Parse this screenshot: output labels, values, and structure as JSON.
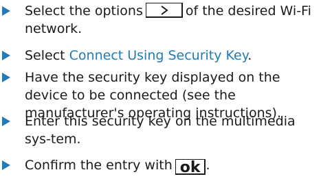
{
  "steps": [
    {
      "before": "Select the options",
      "icon": "chevron-right-icon",
      "after": "of the desired Wi-Fi network."
    },
    {
      "prefix": "Select ",
      "link": "Connect Using Security Key",
      "suffix": "."
    },
    {
      "text": "Have the security key displayed on the device to be connected (see the manufacturer's operating instructions)."
    },
    {
      "text": "Enter this security key on the multimedia sys-tem."
    },
    {
      "before": "Confirm the entry with",
      "key": "ok",
      "after": "."
    }
  ],
  "colors": {
    "accent": "#1f7ab8",
    "text": "#1a1a1a"
  }
}
